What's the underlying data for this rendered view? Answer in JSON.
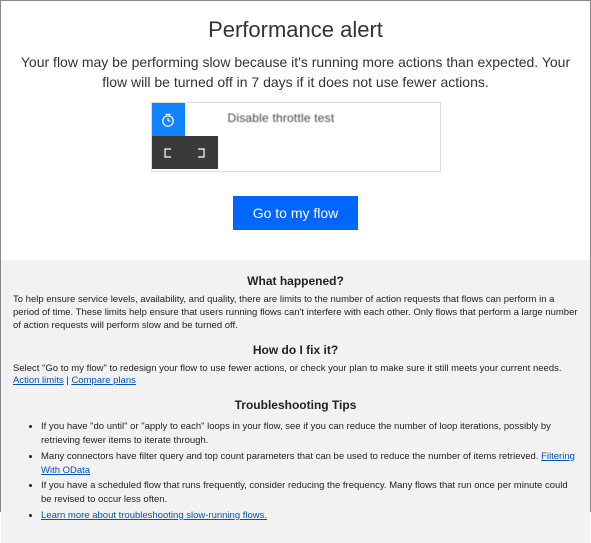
{
  "header": {
    "title": "Performance alert",
    "subtitle": "Your flow may be performing slow because it's running more actions than expected. Your flow will be turned off in 7 days if it does not use fewer actions."
  },
  "flow_card": {
    "label": "Disable throttle test"
  },
  "cta": {
    "label": "Go to my flow"
  },
  "sections": {
    "what_happened": {
      "heading": "What happened?",
      "body": "To help ensure service levels, availability, and quality, there are limits to the number of action requests that flows can perform in a period of time. These limits help ensure that users running flows can't interfere with each other. Only flows that perform a large number of action requests will perform slow and be turned off."
    },
    "how_fix": {
      "heading": "How do I fix it?",
      "body_prefix": "Select \"Go to my flow\" to redesign your flow to use fewer actions, or check your plan to make sure it still meets your current needs. ",
      "link1": "Action limits",
      "separator": " | ",
      "link2": "Compare plans"
    },
    "tips": {
      "heading": "Troubleshooting Tips",
      "items": [
        {
          "text": "If you have \"do until\" or \"apply to each\" loops in your flow, see if you can reduce the number of loop iterations, possibly by retrieving fewer items to iterate through."
        },
        {
          "text_prefix": "Many connectors have filter query and top count parameters that can be used to reduce the number of items retrieved. ",
          "link": "Filtering With OData"
        },
        {
          "text": "If you have a scheduled flow that runs frequently, consider reducing the frequency. Many flows that run once per minute could be revised to occur less often."
        },
        {
          "link": "Learn more about troubleshooting slow-running flows."
        }
      ]
    }
  }
}
